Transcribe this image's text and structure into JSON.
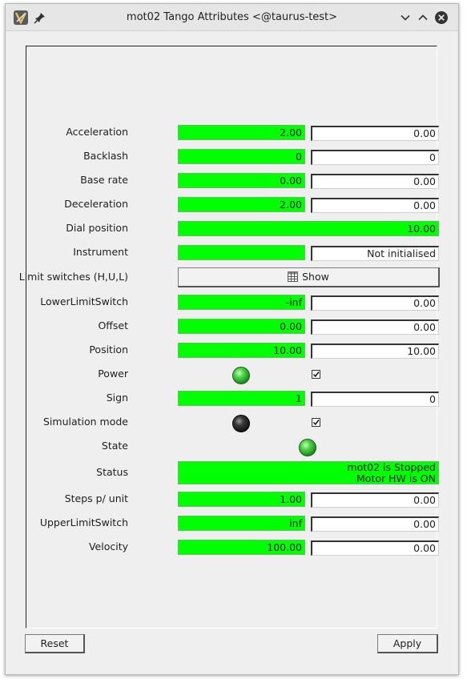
{
  "window": {
    "title": "mot02 Tango Attributes <@taurus-test>"
  },
  "attributes": [
    {
      "name": "Acceleration",
      "read": "2.00",
      "write": "0.00"
    },
    {
      "name": "Backlash",
      "read": "0",
      "write": "0"
    },
    {
      "name": "Base rate",
      "read": "0.00",
      "write": "0.00"
    },
    {
      "name": "Deceleration",
      "read": "2.00",
      "write": "0.00"
    },
    {
      "name": "Dial position",
      "read": "10.00"
    },
    {
      "name": "Instrument",
      "read": "",
      "write": "Not initialised"
    },
    {
      "name": "Limit switches (H,U,L)",
      "button": "Show"
    },
    {
      "name": "LowerLimitSwitch",
      "read": "-inf",
      "write": "0.00"
    },
    {
      "name": "Offset",
      "read": "0.00",
      "write": "0.00"
    },
    {
      "name": "Position",
      "read": "10.00",
      "write": "10.00"
    },
    {
      "name": "Power",
      "led": "on",
      "checked": true
    },
    {
      "name": "Sign",
      "read": "1",
      "write": "0"
    },
    {
      "name": "Simulation mode",
      "led": "off",
      "checked": true
    },
    {
      "name": "State",
      "led": "on"
    },
    {
      "name": "Status",
      "read_lines": [
        "mot02 is Stopped",
        "Motor HW is ON"
      ]
    },
    {
      "name": "Steps p/ unit",
      "read": "1.00",
      "write": "0.00"
    },
    {
      "name": "UpperLimitSwitch",
      "read": "inf",
      "write": "0.00"
    },
    {
      "name": "Velocity",
      "read": "100.00",
      "write": "0.00"
    }
  ],
  "buttons": {
    "reset": "Reset",
    "apply": "Apply"
  },
  "colors": {
    "read_ok": "#00ff00",
    "window_bg": "#efefef"
  },
  "icons": [
    "app-icon",
    "pin-icon",
    "minimize-icon",
    "maximize-icon",
    "close-icon",
    "table-icon",
    "led-green-icon",
    "led-black-icon",
    "checkmark-icon"
  ]
}
